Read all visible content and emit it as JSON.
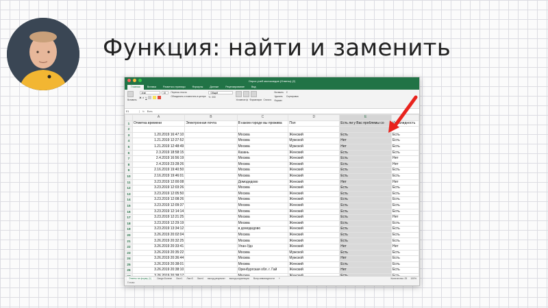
{
  "slide": {
    "title": "Функция: найти и заменить"
  },
  "colors": {
    "excel_green": "#217346",
    "arrow_red": "#e8231d",
    "selected_column": "#d9d9d9"
  },
  "window": {
    "title": "Опрос учеб молокоедов (Ответы) (2)"
  },
  "ribbon": {
    "tabs": [
      "Главная",
      "Вставка",
      "Разметка страницы",
      "Формулы",
      "Данные",
      "Рецензирование",
      "Вид"
    ],
    "font_name": "Arial",
    "font_size": "10",
    "wrap_text": "Перенос текста",
    "merge_center": "Объединить и поместить в центре",
    "number_format": "Общий",
    "paste": "Вставить",
    "conditional_format": "Условное форматирование",
    "format_as_table": "Форматировать как таблицу",
    "cell_styles": "Стили ячеек",
    "insert": "Вставить",
    "delete": "Удалить",
    "format": "Формат",
    "sort_filter": "Сортировка и фильтр"
  },
  "formula_bar": {
    "cell_ref": "E1",
    "fx": "fx",
    "value": "Есть"
  },
  "columns": [
    "A",
    "B",
    "C",
    "D",
    "E"
  ],
  "header_row": {
    "a": "Отметка времени",
    "b": "Электронная почта",
    "c": "В каком городе вы прожива",
    "d": "Пол",
    "e": "Есть ли у Вас проблемы со",
    "f": "Инвалидность"
  },
  "rows": [
    {
      "n": "3",
      "a": "1.20.2019 16:47:10",
      "c": "Москва",
      "d": "Женский",
      "e": "Есть",
      "f": "Есть"
    },
    {
      "n": "4",
      "a": "1.21.2019 12:27:52",
      "c": "Москва",
      "d": "Мужской",
      "e": "Нет",
      "f": "Есть"
    },
    {
      "n": "5",
      "a": "1.21.2019 12:48:49",
      "c": "Москва",
      "d": "Мужской",
      "e": "Нет",
      "f": "Есть"
    },
    {
      "n": "6",
      "a": "2.3.2019 18:58:15",
      "c": "Казань",
      "d": "Женский",
      "e": "Есть",
      "f": "Есть"
    },
    {
      "n": "7",
      "a": "2.4.2019 16:56:19",
      "c": "Москва",
      "d": "Женский",
      "e": "Есть",
      "f": "Нет"
    },
    {
      "n": "8",
      "a": "2.4.2019 23:28:26",
      "c": "Москва",
      "d": "Женский",
      "e": "Есть",
      "f": "Нет"
    },
    {
      "n": "9",
      "a": "2.16.2019 19:40:50",
      "c": "Москва",
      "d": "Женский",
      "e": "Есть",
      "f": "Есть"
    },
    {
      "n": "10",
      "a": "2.16.2019 19:46:01",
      "c": "Москва",
      "d": "Женский",
      "e": "Есть",
      "f": "Есть"
    },
    {
      "n": "11",
      "a": "3.23.2019 12:00:08",
      "c": "Домодедово",
      "d": "Женский",
      "e": "Нет",
      "f": "Нет"
    },
    {
      "n": "12",
      "a": "3.23.2019 12:03:26",
      "c": "Москва",
      "d": "Женский",
      "e": "Есть",
      "f": "Есть"
    },
    {
      "n": "13",
      "a": "3.23.2019 12:05:50",
      "c": "Москва",
      "d": "Женский",
      "e": "Есть",
      "f": "Есть"
    },
    {
      "n": "14",
      "a": "3.23.2019 12:08:26",
      "c": "Москва",
      "d": "Женский",
      "e": "Есть",
      "f": "Есть"
    },
    {
      "n": "15",
      "a": "3.23.2019 12:09:37",
      "c": "Москва",
      "d": "Женский",
      "e": "Есть",
      "f": "Есть"
    },
    {
      "n": "16",
      "a": "3.23.2019 12:14:14",
      "c": "Москва",
      "d": "Женский",
      "e": "Есть",
      "f": "Есть"
    },
    {
      "n": "17",
      "a": "3.23.2019 12:21:25",
      "c": "Москва",
      "d": "Женский",
      "e": "Есть",
      "f": "Нет"
    },
    {
      "n": "18",
      "a": "3.23.2019 12:29:19",
      "c": "Москва",
      "d": "Женский",
      "e": "Есть",
      "f": "Есть"
    },
    {
      "n": "19",
      "a": "3.23.2019 13:34:12",
      "c": "в домодедово",
      "d": "Женский",
      "e": "Есть",
      "f": "Есть"
    },
    {
      "n": "20",
      "a": "3.26.2019 20:02:04",
      "c": "Москва",
      "d": "Женский",
      "e": "Есть",
      "f": "Есть"
    },
    {
      "n": "21",
      "a": "3.26.2019 20:32:25",
      "c": "Москва",
      "d": "Женский",
      "e": "Есть",
      "f": "Есть"
    },
    {
      "n": "22",
      "a": "3.26.2019 20:33:41",
      "c": "Улан-Удэ",
      "d": "Женский",
      "e": "Нет",
      "f": "Нет"
    },
    {
      "n": "23",
      "a": "3.26.2019 20:35:22",
      "c": "Москва",
      "d": "Мужской",
      "e": "Есть",
      "f": "Есть"
    },
    {
      "n": "24",
      "a": "3.26.2019 20:36:44",
      "c": "Москва",
      "d": "Мужской",
      "e": "Нет",
      "f": "Есть"
    },
    {
      "n": "25",
      "a": "3.26.2019 20:38:01",
      "c": "Москва",
      "d": "Женский",
      "e": "Есть",
      "f": "Есть"
    },
    {
      "n": "26",
      "a": "3.26.2019 20:38:10",
      "c": "Оренбургская обл. г. Гай",
      "d": "Женский",
      "e": "Нет",
      "f": "Есть"
    },
    {
      "n": "27",
      "a": "3.26.2019 20:38:17",
      "c": "Москва",
      "d": "Женский",
      "e": "Есть",
      "f": "Есть"
    }
  ],
  "sheets": [
    "Ответы на форму (1)",
    "Сводн.Болезн",
    "Лист1",
    "Лист3",
    "Лист4",
    "выход.результат",
    "выход.корреляция",
    "Вопр.инвалидности"
  ],
  "status": {
    "ready": "Готово",
    "count": "Количество: 25",
    "zoom": "100%"
  }
}
